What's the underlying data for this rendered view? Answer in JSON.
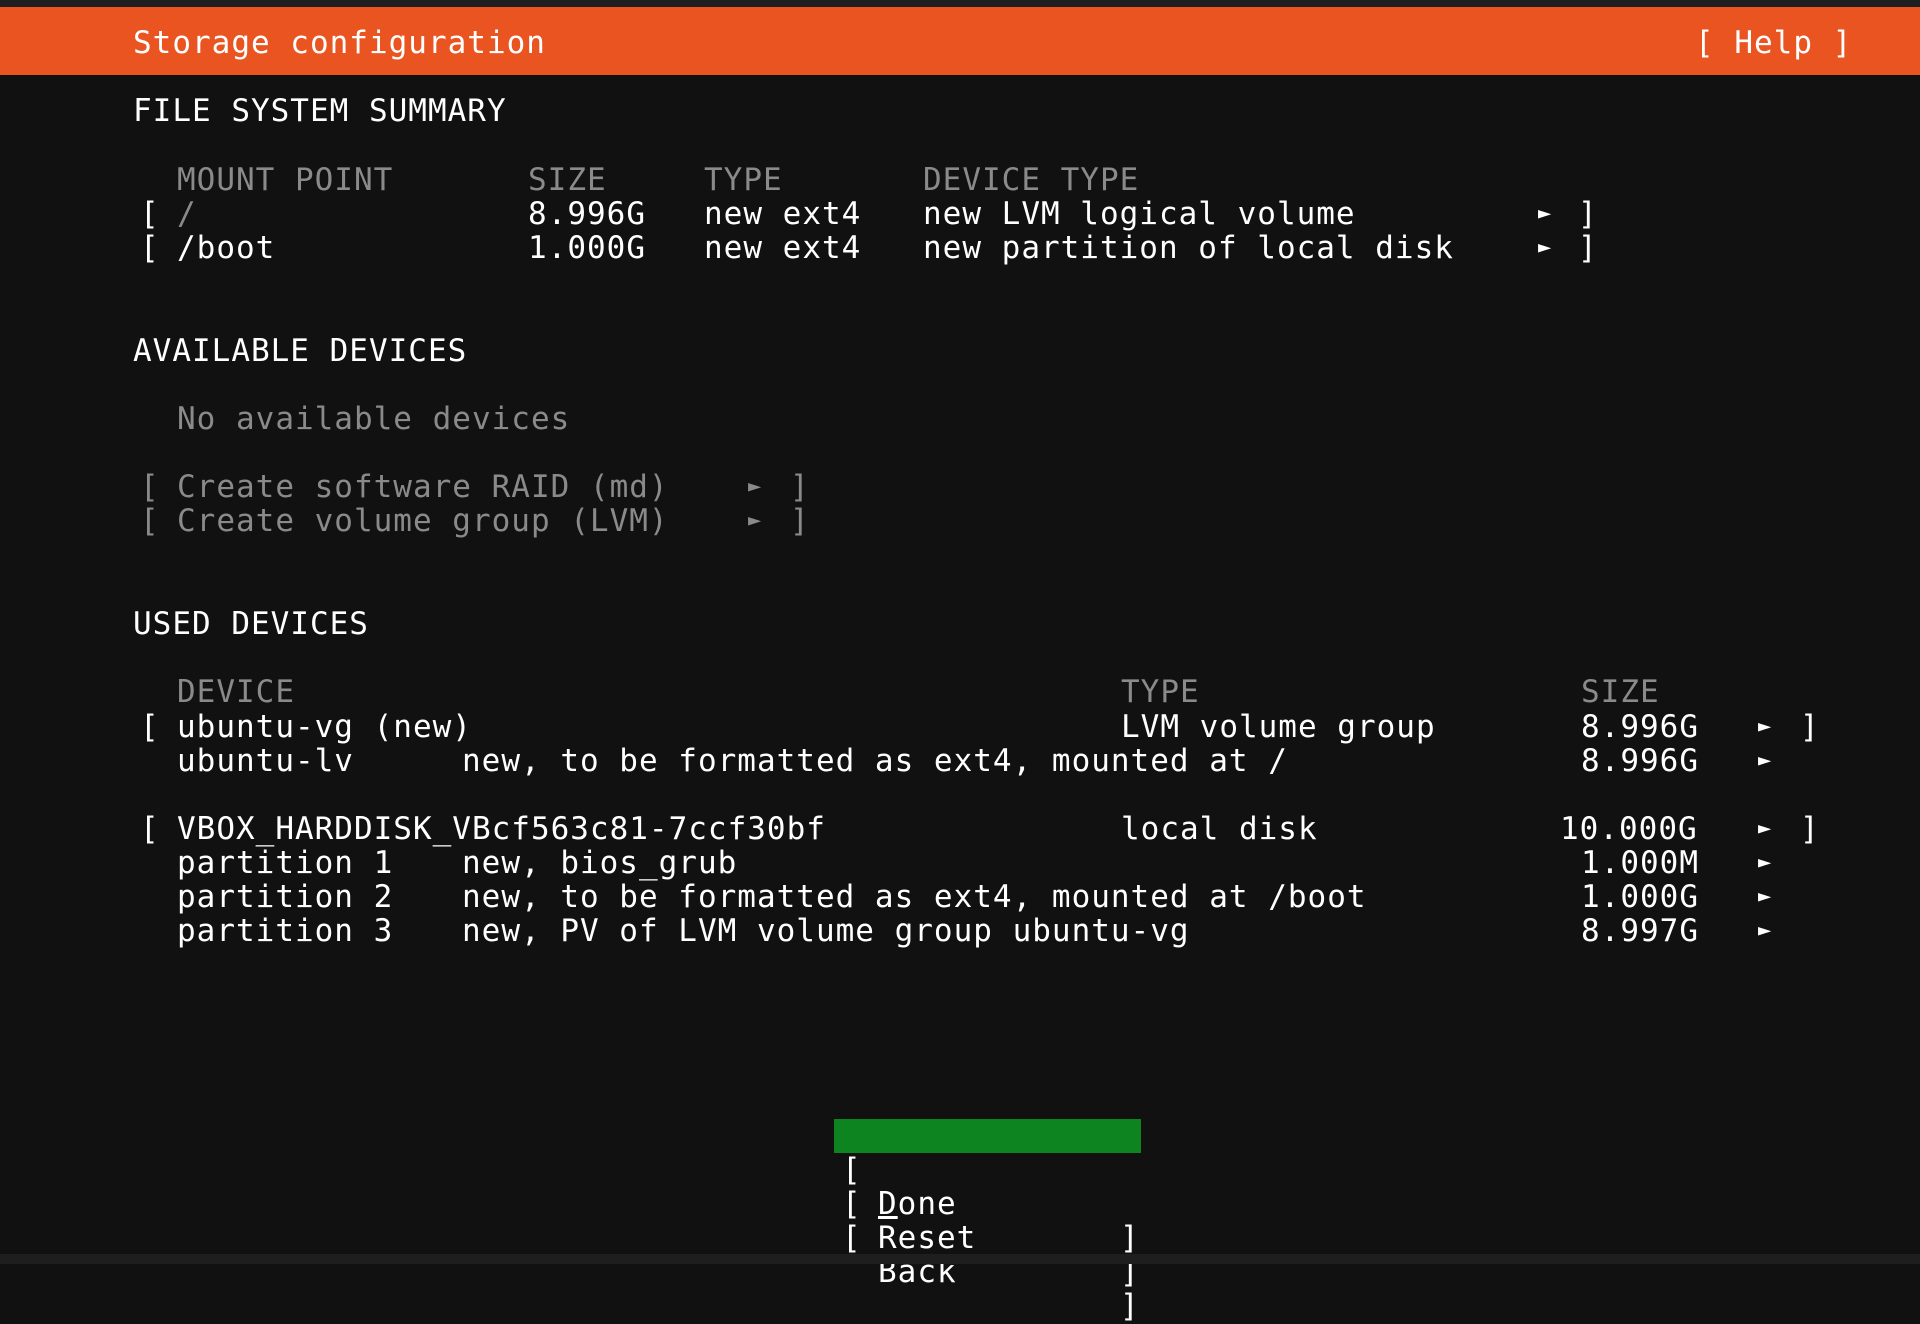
{
  "header": {
    "title": "Storage configuration",
    "help_label": "[ Help ]",
    "color": "#e95420"
  },
  "filesystem_summary": {
    "heading": "FILE SYSTEM SUMMARY",
    "columns": [
      "MOUNT POINT",
      "SIZE",
      "TYPE",
      "DEVICE TYPE"
    ],
    "rows": [
      {
        "mount": "/",
        "size": "8.996G",
        "type": "new ext4",
        "device_type": "new LVM logical volume"
      },
      {
        "mount": "/boot",
        "size": "1.000G",
        "type": "new ext4",
        "device_type": "new partition of local disk"
      }
    ]
  },
  "available_devices": {
    "heading": "AVAILABLE DEVICES",
    "empty_text": "No available devices",
    "actions": [
      "Create software RAID (md)",
      "Create volume group (LVM)"
    ]
  },
  "used_devices": {
    "heading": "USED DEVICES",
    "columns": [
      "DEVICE",
      "TYPE",
      "SIZE"
    ],
    "groups": [
      {
        "device": "ubuntu-vg (new)",
        "type": "LVM volume group",
        "size": "8.996G",
        "children": [
          {
            "name": "ubuntu-lv",
            "desc": "new, to be formatted as ext4, mounted at /",
            "size": "8.996G"
          }
        ]
      },
      {
        "device": "VBOX_HARDDISK_VBcf563c81-7ccf30bf",
        "type": "local disk",
        "size": "10.000G",
        "children": [
          {
            "name": "partition 1",
            "desc": "new, bios_grub",
            "size": "1.000M"
          },
          {
            "name": "partition 2",
            "desc": "new, to be formatted as ext4, mounted at /boot",
            "size": "1.000G"
          },
          {
            "name": "partition 3",
            "desc": "new, PV of LVM volume group ubuntu-vg",
            "size": "8.997G"
          }
        ]
      }
    ]
  },
  "buttons": {
    "done_key": "D",
    "done_rest": "one",
    "reset": "Reset",
    "back": "Back",
    "focus_color": "#0e8420"
  },
  "icons": {
    "arrow": "right-triangle-icon"
  }
}
